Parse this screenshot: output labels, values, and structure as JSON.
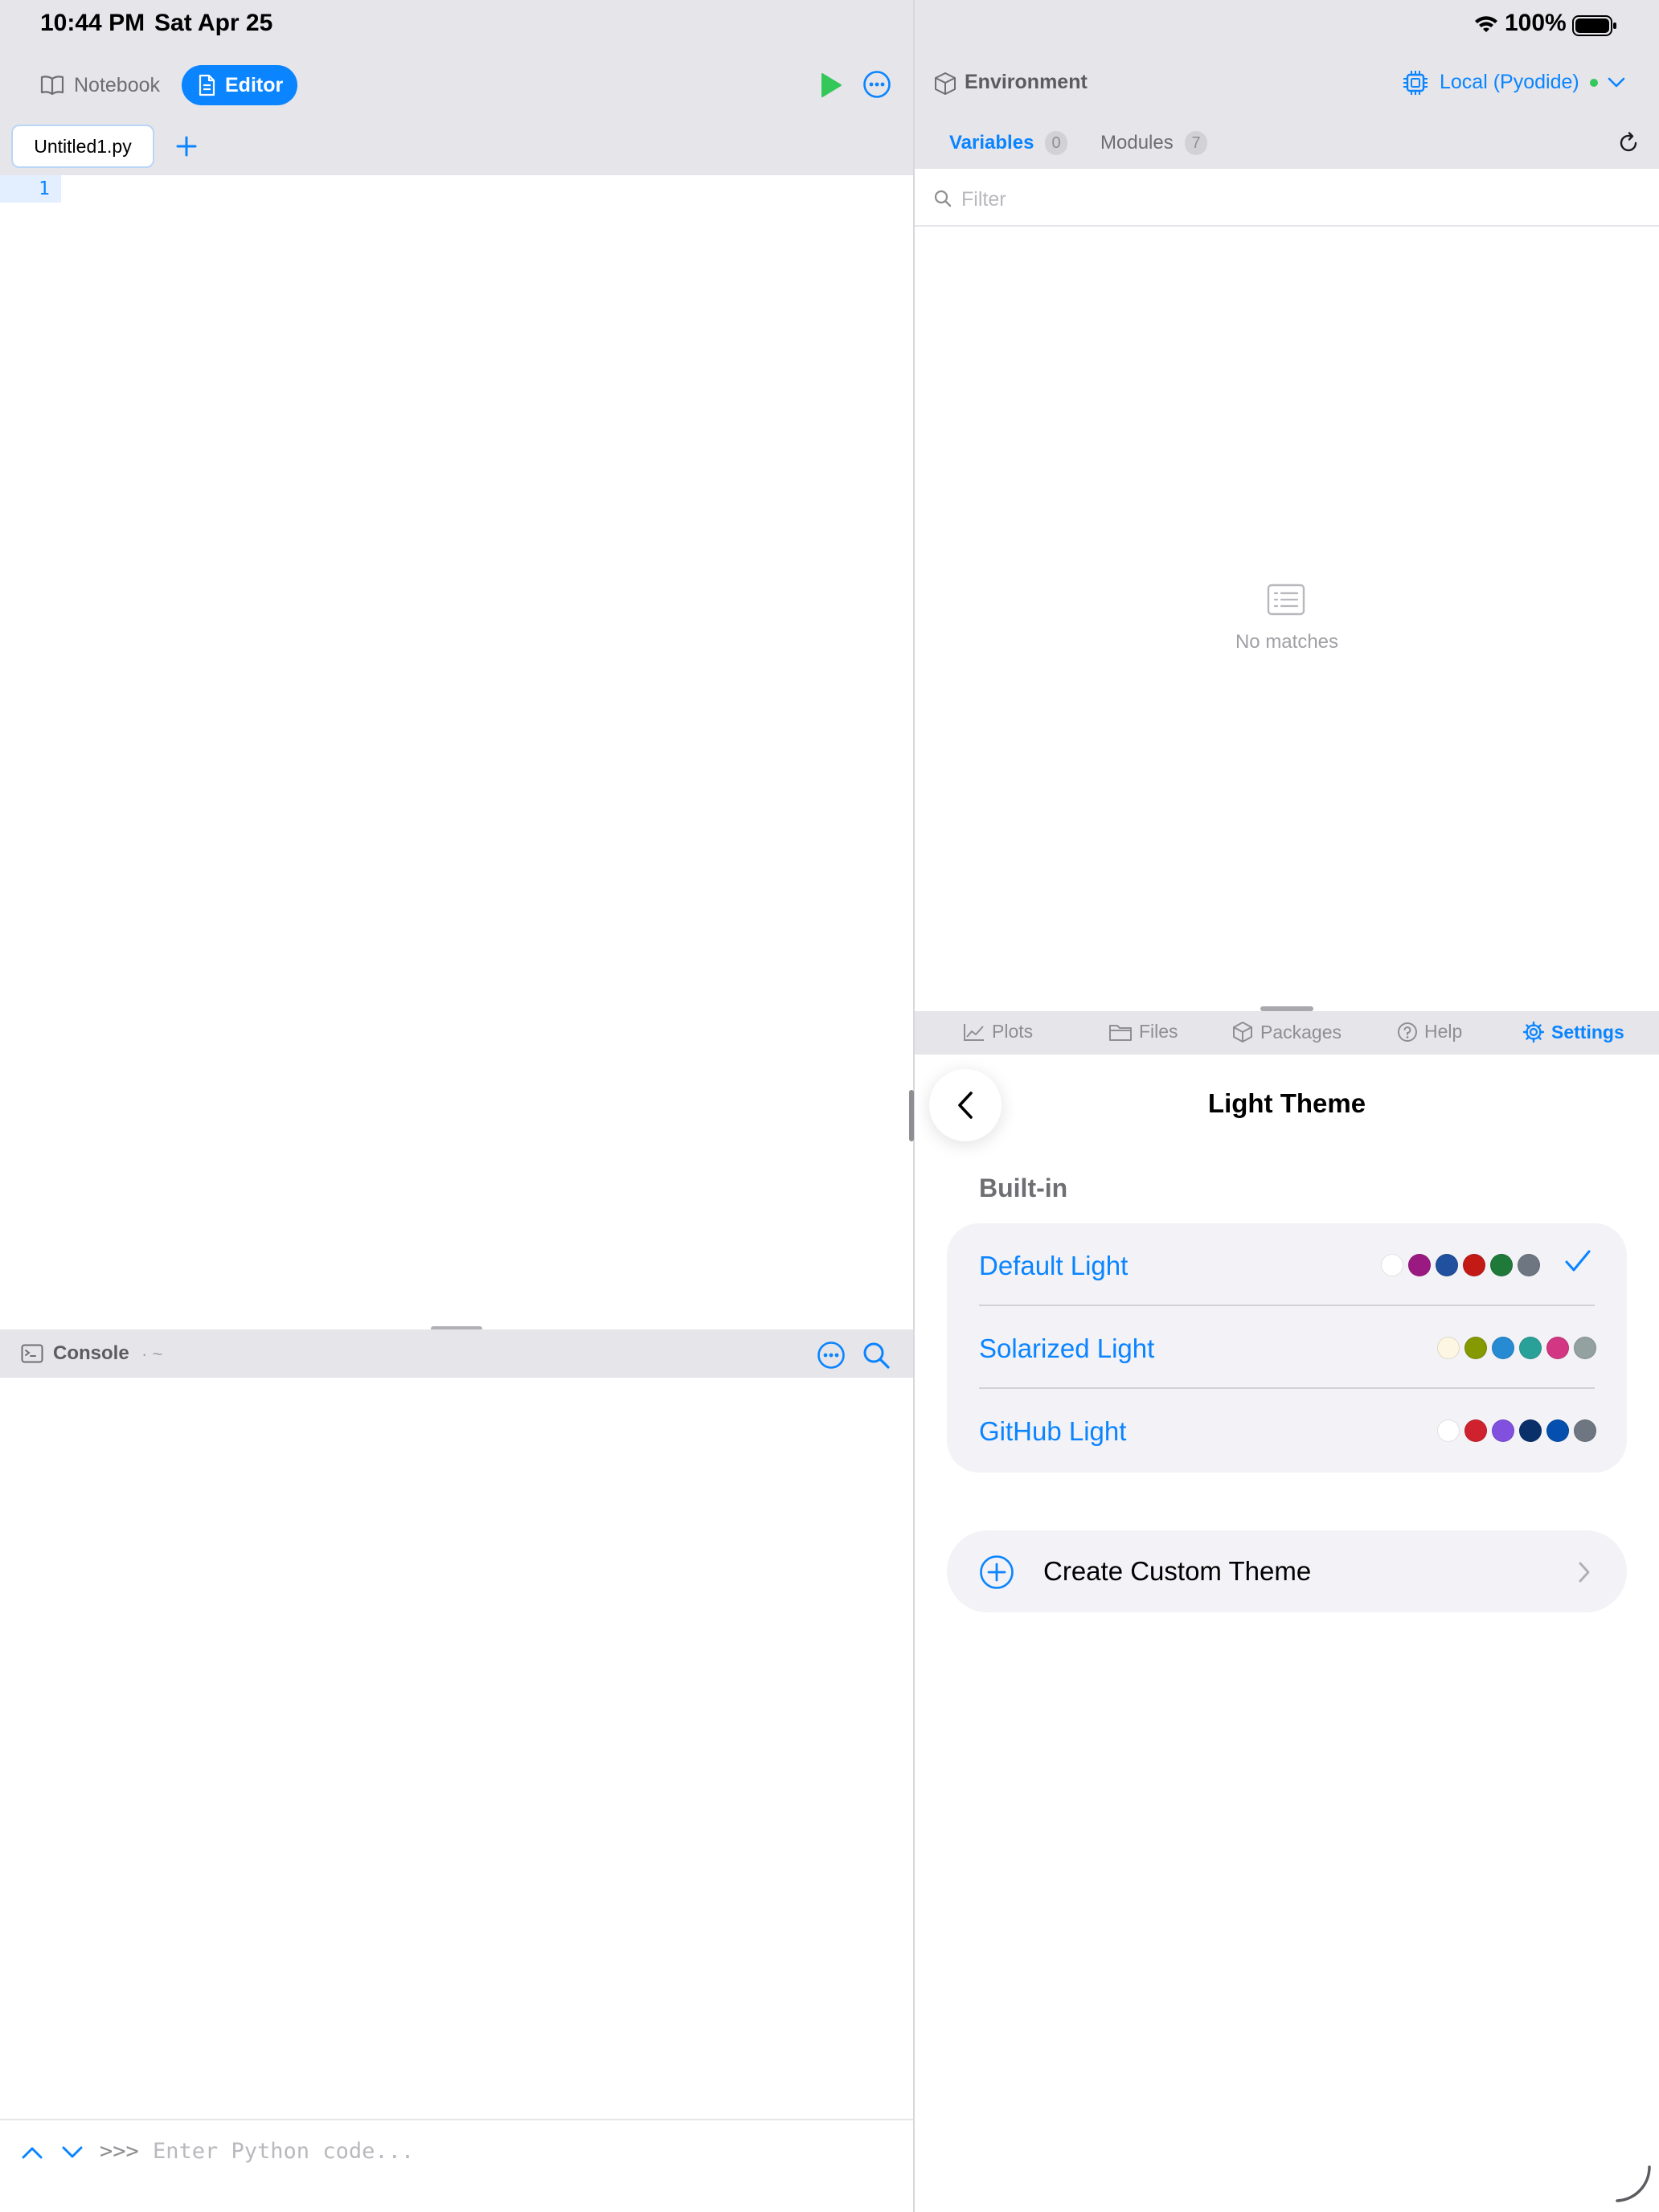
{
  "status_bar": {
    "time": "10:44 PM",
    "date": "Sat Apr 25",
    "battery": "100%"
  },
  "left_pane": {
    "segments": {
      "notebook": "Notebook",
      "editor": "Editor"
    },
    "file_tab": "Untitled1.py",
    "editor": {
      "line_numbers": [
        "1"
      ]
    },
    "console": {
      "title": "Console",
      "path": "· ~",
      "prompt": ">>>",
      "placeholder": "Enter Python code..."
    }
  },
  "right_pane": {
    "environment_title": "Environment",
    "kernel": {
      "label": "Local (Pyodide)",
      "status_color": "#34c759"
    },
    "tabs": [
      {
        "label": "Variables",
        "count": "0",
        "active": true
      },
      {
        "label": "Modules",
        "count": "7",
        "active": false
      }
    ],
    "filter_placeholder": "Filter",
    "empty_state": "No matches",
    "bottom_tabs": [
      {
        "label": "Plots",
        "icon": "chart-icon"
      },
      {
        "label": "Files",
        "icon": "folder-icon"
      },
      {
        "label": "Packages",
        "icon": "package-icon"
      },
      {
        "label": "Help",
        "icon": "help-icon"
      },
      {
        "label": "Settings",
        "icon": "gear-icon",
        "active": true
      }
    ],
    "settings": {
      "title": "Light Theme",
      "section_header": "Built-in",
      "themes": [
        {
          "name": "Default Light",
          "selected": true,
          "swatches": [
            "#ffffff",
            "#9b1a82",
            "#20509e",
            "#c41a16",
            "#1f7a3a",
            "#6e7781"
          ]
        },
        {
          "name": "Solarized Light",
          "selected": false,
          "swatches": [
            "#fdf6e3",
            "#859900",
            "#268bd2",
            "#2aa198",
            "#d33682",
            "#93a1a1"
          ]
        },
        {
          "name": "GitHub Light",
          "selected": false,
          "swatches": [
            "#ffffff",
            "#cf222e",
            "#8250df",
            "#0a3069",
            "#0550ae",
            "#6e7781"
          ]
        }
      ],
      "create_button": "Create Custom Theme"
    }
  },
  "colors": {
    "accent": "#0a84ff",
    "run": "#34c759",
    "chrome": "#e5e5ea",
    "card": "#f2f2f7"
  }
}
